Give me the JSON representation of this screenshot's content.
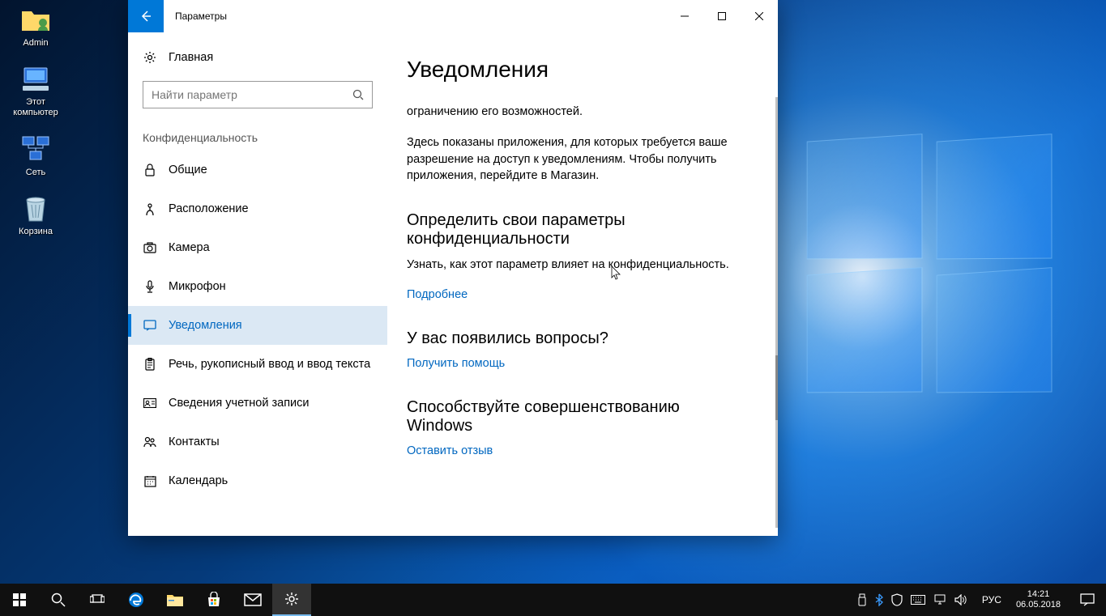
{
  "desktop_icons": [
    {
      "name": "admin",
      "label": "Admin"
    },
    {
      "name": "this-pc",
      "label": "Этот компьютер"
    },
    {
      "name": "network",
      "label": "Сеть"
    },
    {
      "name": "recycle-bin",
      "label": "Корзина"
    }
  ],
  "settings": {
    "title": "Параметры",
    "home": "Главная",
    "search_placeholder": "Найти параметр",
    "section": "Конфиденциальность",
    "nav": {
      "general": "Общие",
      "location": "Расположение",
      "camera": "Камера",
      "microphone": "Микрофон",
      "notifications": "Уведомления",
      "speech": "Речь, рукописный ввод и ввод текста",
      "account": "Сведения учетной записи",
      "contacts": "Контакты",
      "calendar": "Календарь"
    },
    "content": {
      "heading": "Уведомления",
      "line1": "ограничению его возможностей.",
      "line2": "Здесь показаны приложения, для которых требуется ваше разрешение на доступ к уведомлениям. Чтобы получить приложения, перейдите в Магазин.",
      "s1_title": "Определить свои параметры конфиденциальности",
      "s1_text": "Узнать, как этот параметр влияет на конфиденциальность.",
      "s1_link": "Подробнее",
      "s2_title": "У вас появились вопросы?",
      "s2_link": "Получить помощь",
      "s3_title": "Способствуйте совершенствованию Windows",
      "s3_link": "Оставить отзыв"
    }
  },
  "taskbar": {
    "language": "РУС",
    "time": "14:21",
    "date": "06.05.2018"
  }
}
